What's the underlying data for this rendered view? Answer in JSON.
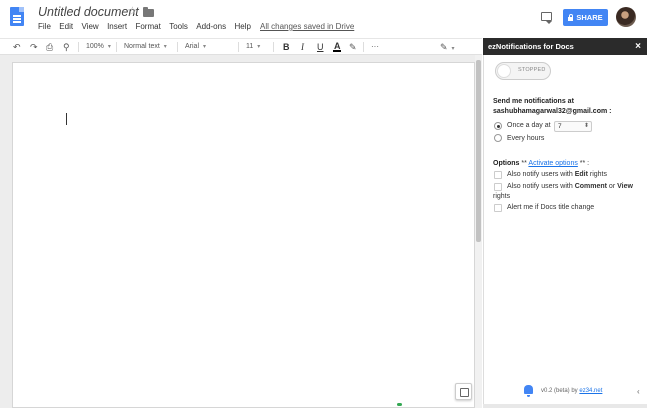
{
  "app": {
    "title": "Untitled document",
    "saved_status": "All changes saved in Drive",
    "share_label": "SHARE"
  },
  "menu": [
    "File",
    "Edit",
    "View",
    "Insert",
    "Format",
    "Tools",
    "Add-ons",
    "Help"
  ],
  "toolbar": {
    "zoom": "100%",
    "style": "Normal text",
    "font": "Arial",
    "size": "11",
    "bold": "B",
    "italic": "I",
    "underline": "U",
    "text_color": "A",
    "more": "···"
  },
  "panel": {
    "title": "ezNotifications for Docs",
    "close": "×",
    "toggle_state": "STOPPED",
    "notify_heading": "Send me notifications at",
    "email": "sashubhamagarwal32@gmail.com :",
    "option_once_prefix": "Once a day at",
    "once_time": "7",
    "option_every": "Every hours",
    "options_label": "Options",
    "activate_prefix": "** ",
    "activate_link": "Activate options",
    "activate_suffix": " ** :",
    "edit_pre": "Also notify users with ",
    "edit_bold": "Edit",
    "edit_post": " rights",
    "comment_pre": "Also notify users with ",
    "comment_bold": "Comment",
    "comment_mid": " or ",
    "comment_bold2": "View",
    "comment_post": "rights",
    "title_change": "Alert me if Docs title change",
    "footer_prefix": "v0.2 (beta) by ",
    "footer_link": "ez34.net"
  },
  "colors": {
    "accent": "#4285f4",
    "panel_header": "#2b2b2b",
    "doc_background": "#ededed"
  },
  "icons": [
    "docs-logo-icon",
    "star-icon",
    "folder-icon",
    "comments-icon",
    "lock-icon",
    "undo-icon",
    "redo-icon",
    "print-icon",
    "paint-format-icon",
    "pencil-icon",
    "highlight-icon",
    "bell-icon",
    "explore-icon",
    "chevron-left-icon"
  ]
}
